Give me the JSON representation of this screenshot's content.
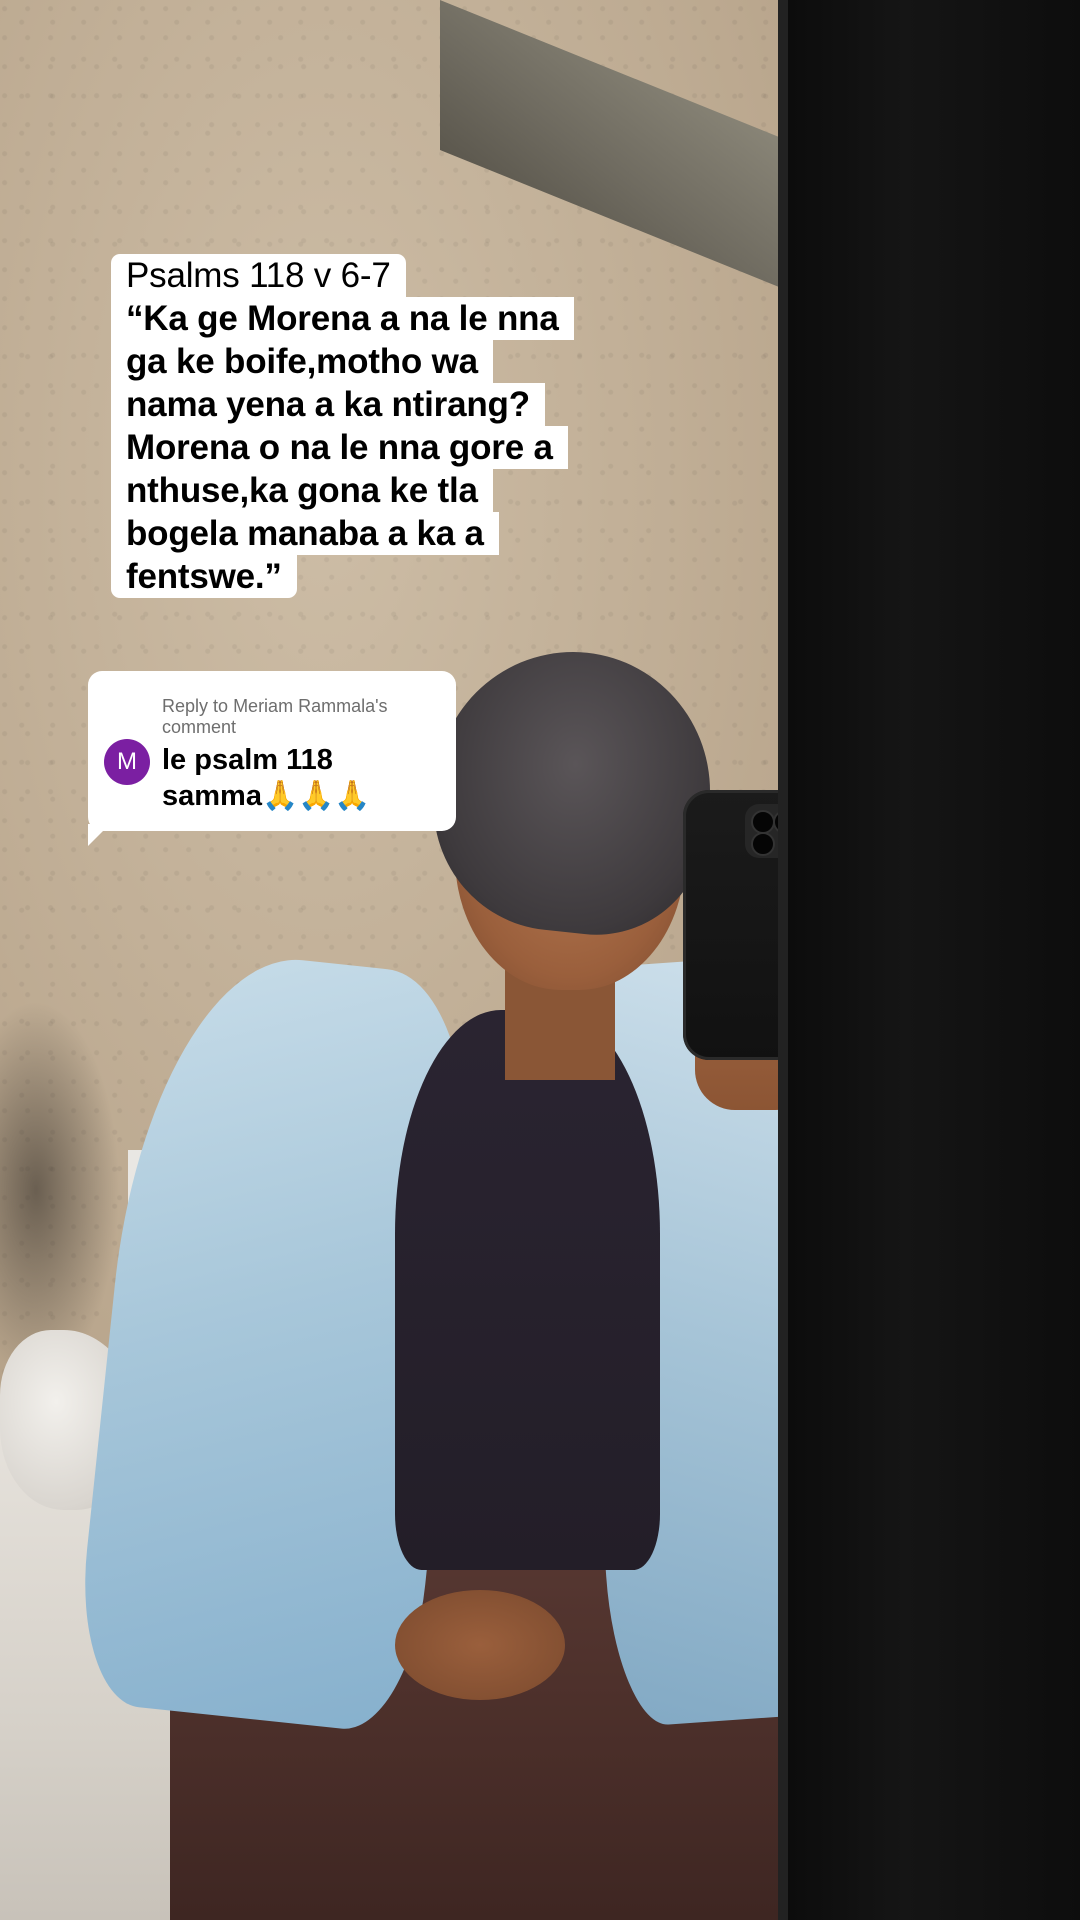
{
  "caption": {
    "lines": [
      "Psalms 118 v 6-7",
      "“Ka ge Morena a na le nna",
      "ga ke boife,motho wa",
      "nama yena a ka ntirang?",
      "Morena o na le nna gore a",
      "nthuse,ka gona ke tla",
      "bogela manaba a ka a",
      "fentswe.”"
    ]
  },
  "reply": {
    "prefix": "Reply to",
    "author": "Meriam Rammala's",
    "suffix": "comment",
    "avatar_letter": "M",
    "avatar_color": "#7b1fa2",
    "text_line1": "le psalm 118",
    "text_line2": "samma🙏🙏🙏"
  }
}
